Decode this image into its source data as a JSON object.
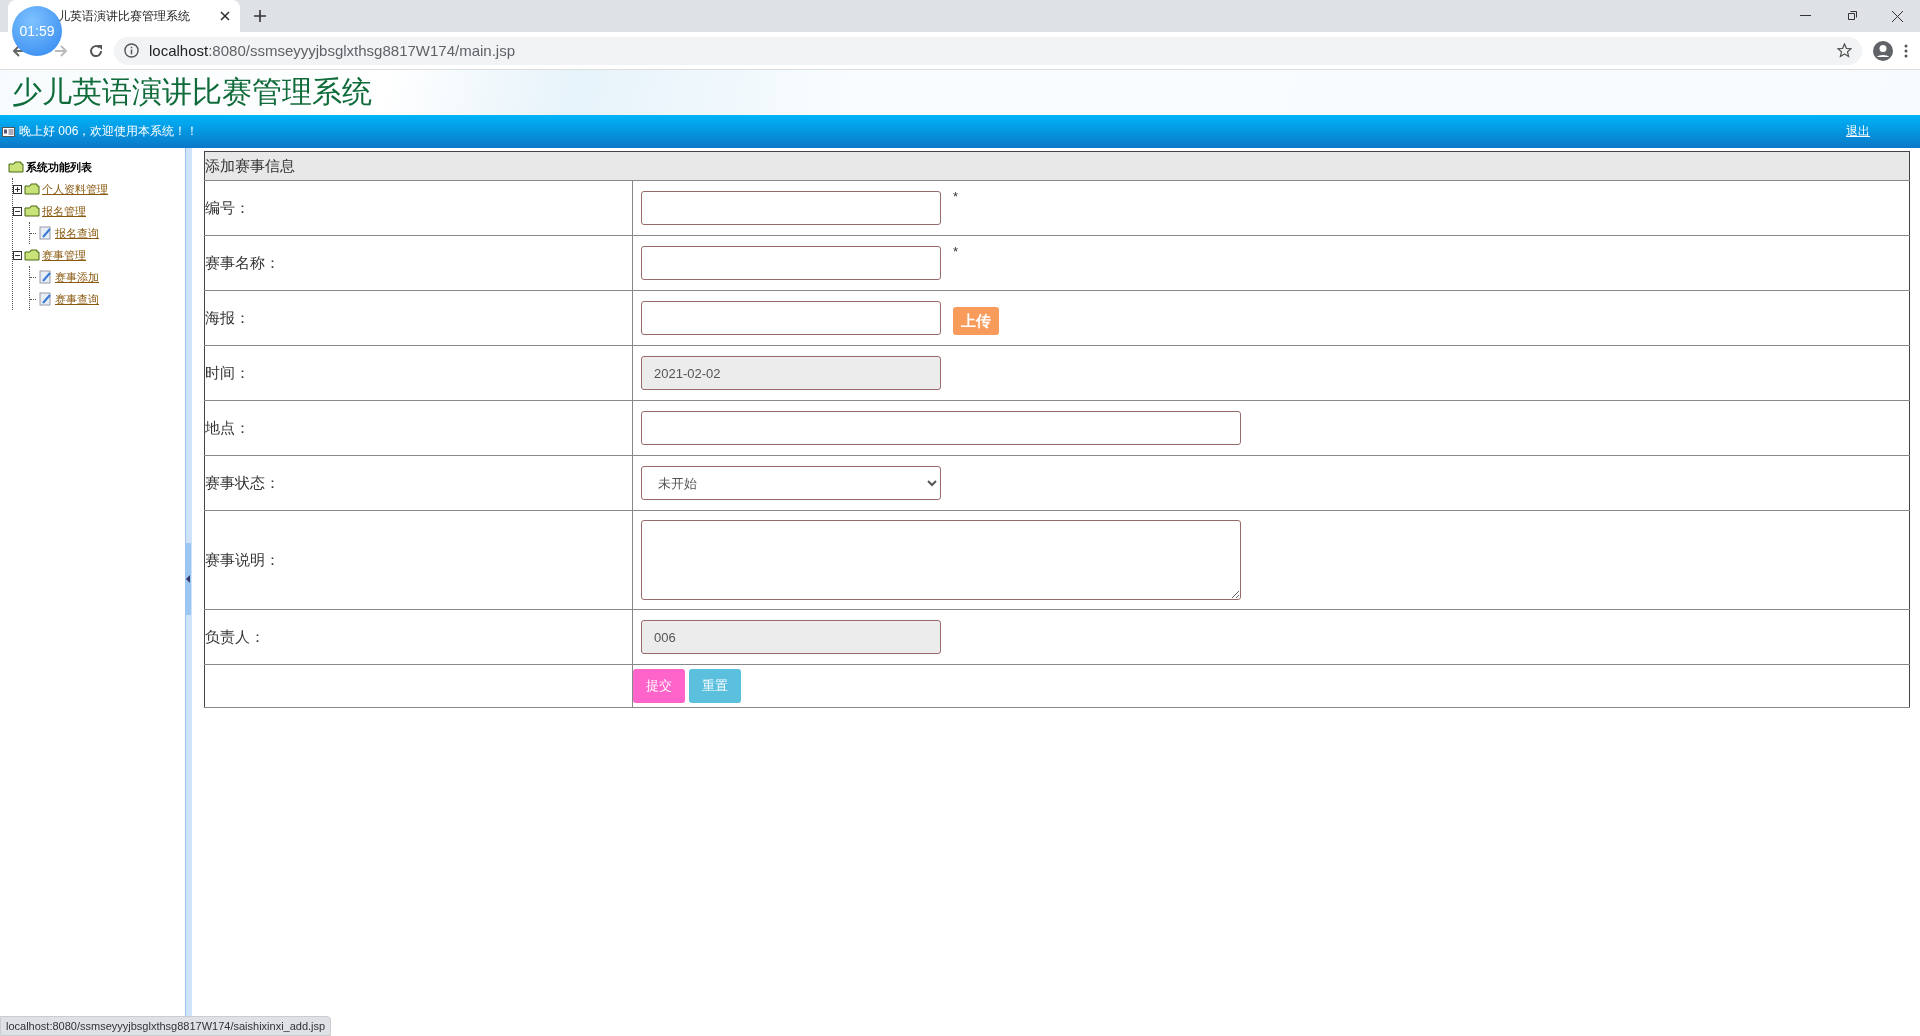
{
  "browser": {
    "timer": "01:59",
    "tab_title": "儿英语演讲比赛管理系统",
    "url_host": "localhost",
    "url_rest": ":8080/ssmseyyyjbsglxthsg8817W174/main.jsp",
    "status_url": "localhost:8080/ssmseyyyjbsglxthsg8817W174/saishixinxi_add.jsp"
  },
  "header": {
    "title": "少儿英语演讲比赛管理系统",
    "greeting": "晚上好 006，欢迎使用本系统！！",
    "logout": "退出"
  },
  "sidebar": {
    "root": "系统功能列表",
    "items": [
      {
        "label": "个人资料管理",
        "expanded": false
      },
      {
        "label": "报名管理",
        "expanded": true,
        "children": [
          {
            "label": "报名查询"
          }
        ]
      },
      {
        "label": "赛事管理",
        "expanded": true,
        "children": [
          {
            "label": "赛事添加"
          },
          {
            "label": "赛事查询"
          }
        ]
      }
    ]
  },
  "form": {
    "title": "添加赛事信息",
    "fields": [
      {
        "kind": "text",
        "label": "编号：",
        "readonly": false,
        "required_mark": "*"
      },
      {
        "kind": "text",
        "label": "赛事名称：",
        "readonly": false,
        "required_mark": "*"
      },
      {
        "kind": "upload",
        "label": "海报：",
        "readonly": false,
        "button": "上传"
      },
      {
        "kind": "text",
        "label": "时间：",
        "readonly": true,
        "value": "2021-02-02"
      },
      {
        "kind": "wide",
        "label": "地点：",
        "readonly": false
      },
      {
        "kind": "select",
        "label": "赛事状态：",
        "value": "未开始"
      },
      {
        "kind": "textarea",
        "label": "赛事说明："
      },
      {
        "kind": "text",
        "label": "负责人：",
        "readonly": true,
        "value": "006"
      }
    ],
    "buttons": [
      {
        "kind": "submit",
        "label": "提交"
      },
      {
        "kind": "reset",
        "label": "重置"
      }
    ]
  }
}
